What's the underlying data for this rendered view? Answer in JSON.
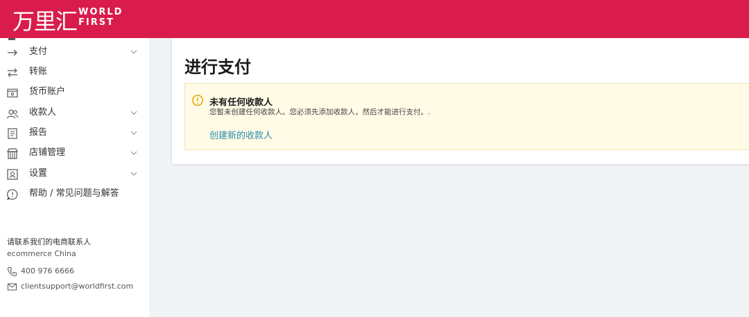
{
  "header": {
    "logo_cn": "万里汇",
    "logo_en_line1": "WORLD",
    "logo_en_line2": "FIRST"
  },
  "sidebar": {
    "items": [
      {
        "label": "支付",
        "icon": "arrow-right-icon",
        "has_chevron": true
      },
      {
        "label": "转账",
        "icon": "transfer-icon",
        "has_chevron": false
      },
      {
        "label": "货币账户",
        "icon": "wallet-icon",
        "has_chevron": false
      },
      {
        "label": "收款人",
        "icon": "users-icon",
        "has_chevron": true
      },
      {
        "label": "报告",
        "icon": "report-icon",
        "has_chevron": true
      },
      {
        "label": "店铺管理",
        "icon": "store-icon",
        "has_chevron": true
      },
      {
        "label": "设置",
        "icon": "settings-icon",
        "has_chevron": true
      },
      {
        "label": "帮助 / 常见问题与解答",
        "icon": "help-icon",
        "has_chevron": false
      }
    ],
    "contact": {
      "title": "请联系我们的电商联系人",
      "subtitle": "ecommerce China",
      "phone": "400 976 6666",
      "email": "clientsupport@worldfirst.com"
    }
  },
  "main": {
    "title": "进行支付",
    "alert": {
      "title": "未有任何收款人",
      "description": "您暂未创建任何收款人。您必须先添加收款人，然后才能进行支付。.",
      "link": "创建新的收款人"
    }
  },
  "colors": {
    "brand": "#d91c4b",
    "link": "#2e8aa8",
    "alert_bg": "#fffbe6",
    "alert_icon": "#e0a800"
  }
}
